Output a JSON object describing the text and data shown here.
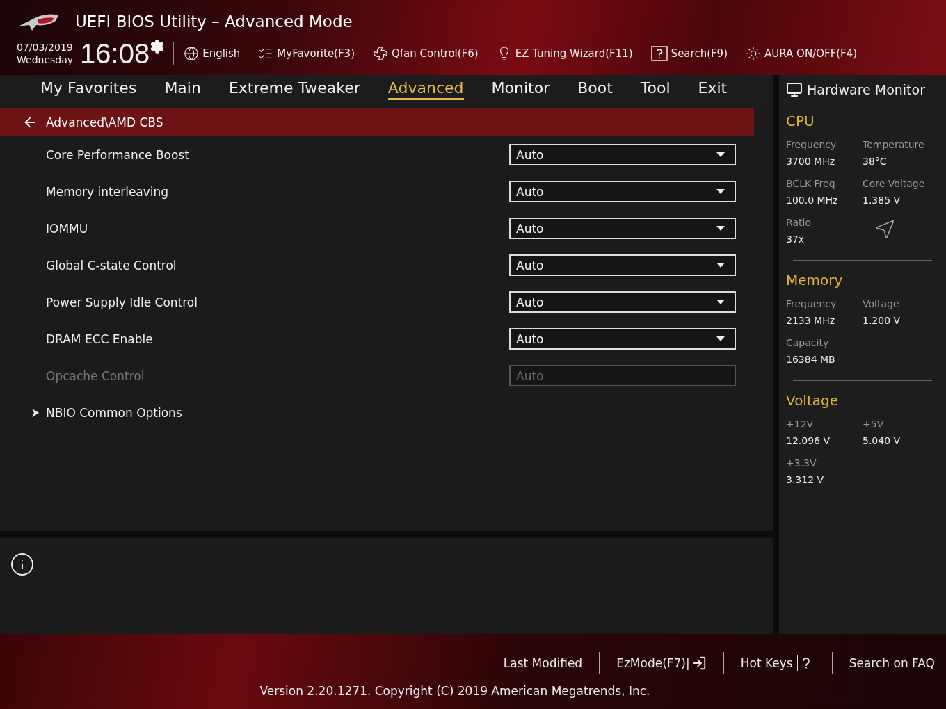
{
  "header": {
    "title": "UEFI BIOS Utility – Advanced Mode",
    "date": "07/03/2019",
    "day": "Wednesday",
    "time": "16:08",
    "toolbar": [
      {
        "label": "English",
        "kind": "globe"
      },
      {
        "label": "MyFavorite(F3)",
        "kind": "list"
      },
      {
        "label": "Qfan Control(F6)",
        "kind": "fan"
      },
      {
        "label": "EZ Tuning Wizard(F11)",
        "kind": "bulb"
      },
      {
        "label": "Search(F9)",
        "kind": "question"
      },
      {
        "label": "AURA ON/OFF(F4)",
        "kind": "aura"
      }
    ]
  },
  "tabs": [
    {
      "label": "My Favorites",
      "selected": false
    },
    {
      "label": "Main",
      "selected": false
    },
    {
      "label": "Extreme Tweaker",
      "selected": false
    },
    {
      "label": "Advanced",
      "selected": true
    },
    {
      "label": "Monitor",
      "selected": false
    },
    {
      "label": "Boot",
      "selected": false
    },
    {
      "label": "Tool",
      "selected": false
    },
    {
      "label": "Exit",
      "selected": false
    }
  ],
  "breadcrumb": "Advanced\\AMD CBS",
  "settings": [
    {
      "kind": "dropdown",
      "label": "Core Performance Boost",
      "value": "Auto",
      "disabled": false
    },
    {
      "kind": "dropdown",
      "label": "Memory interleaving",
      "value": "Auto",
      "disabled": false
    },
    {
      "kind": "dropdown",
      "label": "IOMMU",
      "value": "Auto",
      "disabled": false
    },
    {
      "kind": "dropdown",
      "label": "Global C-state Control",
      "value": "Auto",
      "disabled": false
    },
    {
      "kind": "dropdown",
      "label": "Power Supply Idle Control",
      "value": "Auto",
      "disabled": false
    },
    {
      "kind": "dropdown",
      "label": "DRAM ECC Enable",
      "value": "Auto",
      "disabled": false
    },
    {
      "kind": "dropdown",
      "label": "Opcache Control",
      "value": "Auto",
      "disabled": true
    },
    {
      "kind": "submenu",
      "label": "NBIO Common Options",
      "disabled": false
    }
  ],
  "hardware_monitor": {
    "title": "Hardware Monitor",
    "sections": [
      {
        "title": "CPU",
        "items": [
          {
            "label": "Frequency",
            "value": "3700 MHz"
          },
          {
            "label": "Temperature",
            "value": "38°C"
          },
          {
            "label": "BCLK Freq",
            "value": "100.0 MHz"
          },
          {
            "label": "Core Voltage",
            "value": "1.385 V"
          },
          {
            "label": "Ratio",
            "value": "37x"
          }
        ]
      },
      {
        "title": "Memory",
        "items": [
          {
            "label": "Frequency",
            "value": "2133 MHz"
          },
          {
            "label": "Voltage",
            "value": "1.200 V"
          },
          {
            "label": "Capacity",
            "value": "16384 MB"
          }
        ]
      },
      {
        "title": "Voltage",
        "items": [
          {
            "label": "+12V",
            "value": "12.096 V"
          },
          {
            "label": "+5V",
            "value": "5.040 V"
          },
          {
            "label": "+3.3V",
            "value": "3.312 V"
          }
        ]
      }
    ]
  },
  "footer": {
    "links": [
      {
        "label": "Last Modified",
        "kind": "text"
      },
      {
        "label": "EzMode(F7)|",
        "kind": "exit"
      },
      {
        "label": "Hot Keys",
        "kind": "question"
      },
      {
        "label": "Search on FAQ",
        "kind": "text"
      }
    ],
    "version": "Version 2.20.1271. Copyright (C) 2019 American Megatrends, Inc."
  }
}
